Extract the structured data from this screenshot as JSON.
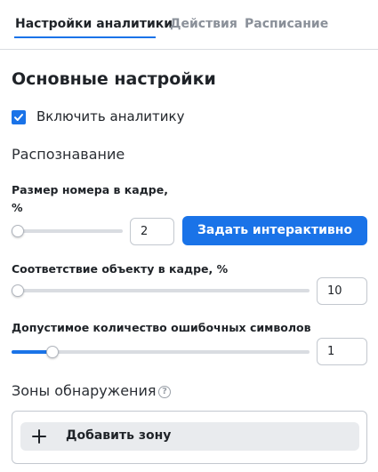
{
  "tabs": [
    {
      "label": "Настройки аналитики",
      "active": true
    },
    {
      "label": "Действия",
      "active": false
    },
    {
      "label": "Расписание",
      "active": false
    }
  ],
  "section_title": "Основные настройки",
  "enable_checkbox": {
    "label": "Включить аналитику",
    "checked": true
  },
  "recognition_heading": "Распознавание",
  "plate_size": {
    "label_line1": "Размер номера в кадре,",
    "label_line2": "%",
    "value": "2",
    "slider_fraction": 0.0,
    "button_label": "Задать интерактивно"
  },
  "object_match": {
    "label": "Соответствие объекту в кадре, %",
    "value": "10",
    "slider_fraction": 0.0
  },
  "error_chars": {
    "label": "Допустимое количество ошибочных символов",
    "value": "1",
    "slider_fraction": 0.12
  },
  "zones": {
    "title": "Зоны обнаружения",
    "help_icon": "question-circle-icon",
    "add_button_label": "Добавить зону",
    "add_icon": "plus-icon"
  },
  "colors": {
    "accent": "#1a73e8",
    "button_bg": "#e9ebee"
  }
}
